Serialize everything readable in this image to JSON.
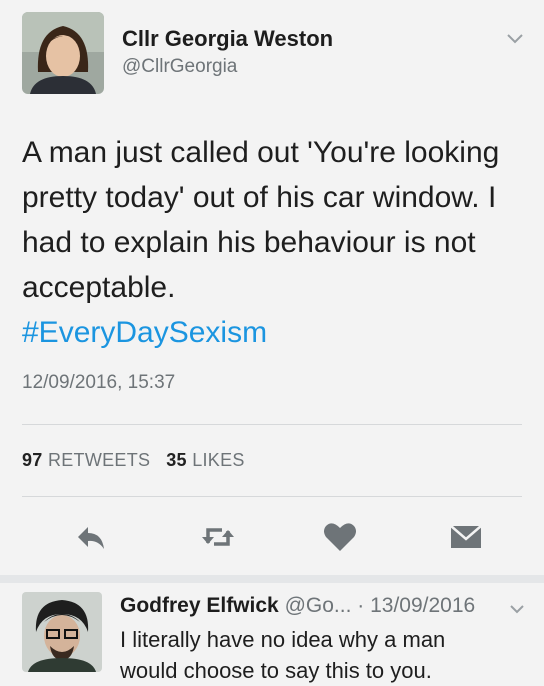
{
  "tweet": {
    "author_name": "Cllr Georgia Weston",
    "author_handle": "@CllrGeorgia",
    "text": "A man just called out 'You're looking pretty today' out of his car window. I had to explain his behaviour is not acceptable.",
    "hashtag": "#EveryDaySexism",
    "timestamp": "12/09/2016, 15:37",
    "retweets_count": "97",
    "retweets_label": "RETWEETS",
    "likes_count": "35",
    "likes_label": "LIKES"
  },
  "reply": {
    "author_name": "Godfrey Elfwick",
    "author_handle": "@Go...",
    "separator": "·",
    "date": "13/09/2016",
    "line1": "I literally have no idea why a man",
    "line2": "would choose to say this to you."
  },
  "colors": {
    "hashtag": "#1b95e0",
    "icon": "#6e7478",
    "muted": "#6e7478"
  },
  "icons": [
    "chevron-down-icon",
    "reply-icon",
    "retweet-icon",
    "heart-icon",
    "direct-message-icon"
  ]
}
